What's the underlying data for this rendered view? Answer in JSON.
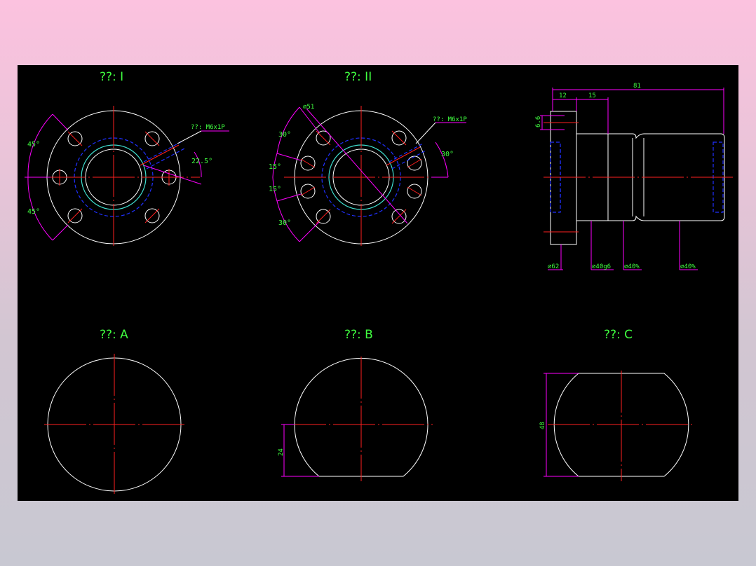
{
  "views": {
    "view_1_title": "??: I",
    "view_2_title": "??: II",
    "view_a_title": "??: A",
    "view_b_title": "??: B",
    "view_c_title": "??: C"
  },
  "view1": {
    "angle_top": "45°",
    "angle_bottom": "45°",
    "thread": "??: M6x1P",
    "angle_thread": "22.5°"
  },
  "view2": {
    "diameter": "⌀51",
    "thread": "??: M6x1P",
    "angle_right": "30°",
    "angle_a": "30°",
    "angle_b": "15°",
    "angle_c": "15°",
    "angle_d": "30°"
  },
  "side_view": {
    "length_total": "81",
    "length_flange": "12",
    "length_step": "15",
    "hole_dim": "6.6",
    "dia_flange": "⌀62",
    "dia_shaft1": "⌀40g6",
    "dia_shaft2": "⌀40%",
    "dia_shaft3": "⌀40%"
  },
  "section_b": {
    "height": "24"
  },
  "section_c": {
    "width": "48"
  }
}
